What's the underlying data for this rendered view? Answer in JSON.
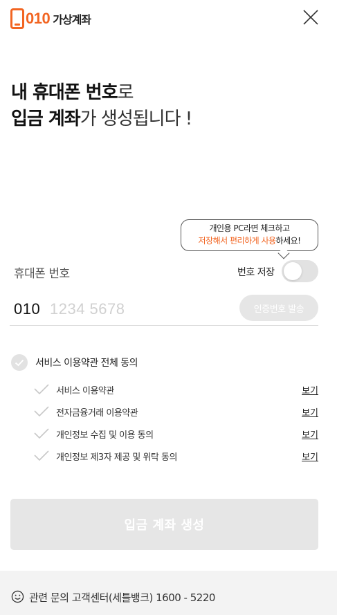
{
  "header": {
    "logo_digits": "010",
    "logo_text": "가상계좌",
    "accent_color": "#f26522"
  },
  "headline": {
    "line1_bold": "내 휴대폰 번호",
    "line1_light": "로",
    "line2_bold": "입금 계좌",
    "line2_light": "가 생성됩니다 !"
  },
  "tooltip": {
    "line1": "개인용 PC라면 체크하고",
    "line2_accent": "저장해서 편리하게 사용",
    "line2_rest": "하세요!"
  },
  "phone": {
    "label": "휴대폰 번호",
    "save_label": "번호 저장",
    "save_enabled": false,
    "prefix": "010",
    "placeholder": "1234 5678",
    "verify_label": "인증번호 발송"
  },
  "agreement": {
    "all_label": "서비스 이용약관 전체 동의",
    "view_label": "보기",
    "items": [
      {
        "label": "서비스 이용약관"
      },
      {
        "label": "전자금융거래 이용약관"
      },
      {
        "label": "개인정보 수집 및 이용 동의"
      },
      {
        "label": "개인정보 제3자 제공 및 위탁 동의"
      }
    ]
  },
  "create_button_label": "입금 계좌 생성",
  "footer": {
    "text": "관련 문의 고객센터(세틀뱅크) 1600 - 5220"
  },
  "icons": {
    "close": "close-icon",
    "check": "check-icon",
    "smile": "smile-icon"
  }
}
